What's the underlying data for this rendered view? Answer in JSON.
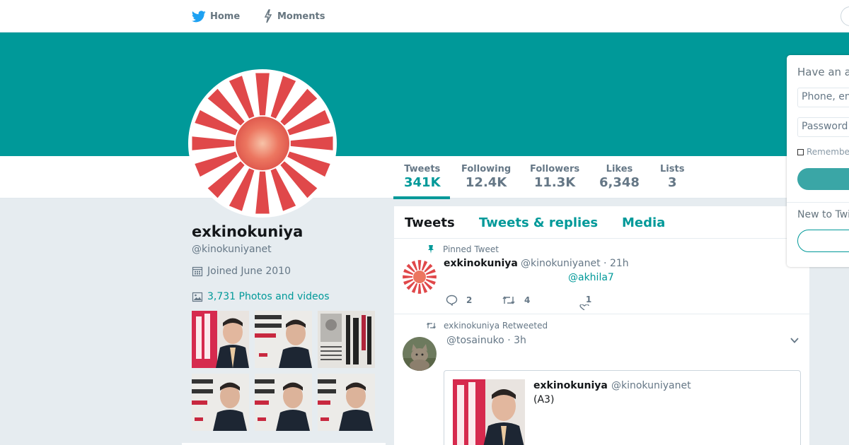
{
  "nav": {
    "home_label": "Home",
    "moments_label": "Moments"
  },
  "colors": {
    "brand": "#009999",
    "text": "#14171a",
    "muted": "#657786",
    "background": "#e6ecf0"
  },
  "profile": {
    "name": "exkinokuniya",
    "handle": "@kinokuniyanet",
    "joined": "Joined June 2010",
    "photos_label": "3,731 Photos and videos"
  },
  "stats": [
    {
      "label": "Tweets",
      "value": "341K"
    },
    {
      "label": "Following",
      "value": "12.4K"
    },
    {
      "label": "Followers",
      "value": "11.3K"
    },
    {
      "label": "Likes",
      "value": "6,348"
    },
    {
      "label": "Lists",
      "value": "3"
    }
  ],
  "tabs": [
    {
      "label": "Tweets"
    },
    {
      "label": "Tweets & replies"
    },
    {
      "label": "Media"
    }
  ],
  "tweets": [
    {
      "context": "Pinned Tweet",
      "name": "exkinokuniya",
      "meta": "@kinokuniyanet · 21h",
      "link": "@akhila7",
      "replies": "2",
      "retweets": "4",
      "likes": "1"
    },
    {
      "context": "exkinokuniya Retweeted",
      "meta": "@tosainuko · 3h",
      "quote": {
        "name": "exkinokuniya",
        "handle": "@kinokuniyanet",
        "text": "(A3)"
      }
    }
  ],
  "login": {
    "title": "Have an ac",
    "phone_placeholder": "Phone, em",
    "password_placeholder": "Password",
    "remember_label": "Remembe",
    "new_to": "New to Twi"
  },
  "icons": [
    "twitter-bird-icon",
    "lightning-icon",
    "calendar-icon",
    "image-icon",
    "pin-icon",
    "reply-icon",
    "retweet-icon",
    "like-icon",
    "chevron-down-icon"
  ]
}
